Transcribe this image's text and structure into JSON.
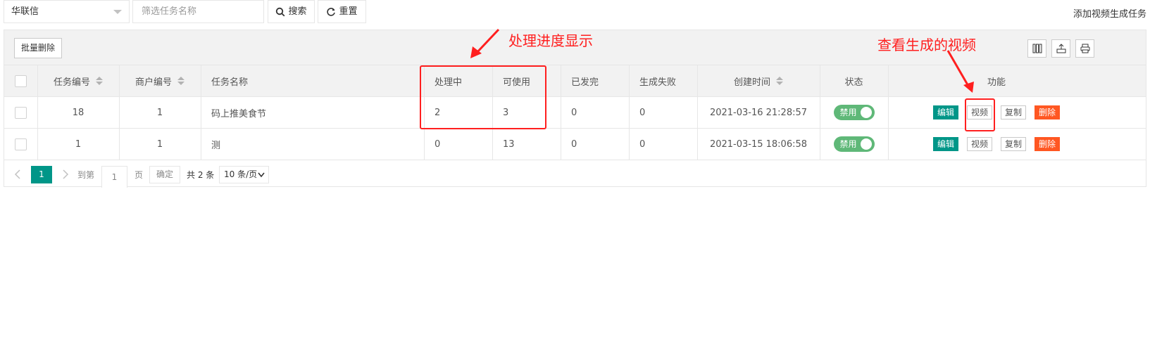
{
  "toolbar": {
    "merchant_select": "华联信",
    "task_name_placeholder": "筛选任务名称",
    "search_label": "搜索",
    "reset_label": "重置",
    "add_task_link": "添加视频生成任务"
  },
  "table_toolbar": {
    "batch_delete_label": "批量删除",
    "icons": [
      "columns-icon",
      "export-icon",
      "print-icon"
    ]
  },
  "columns": {
    "task_id": "任务编号",
    "merchant_id": "商户编号",
    "task_name": "任务名称",
    "processing": "处理中",
    "available": "可使用",
    "sent": "已发完",
    "failed": "生成失败",
    "created_at": "创建时间",
    "status": "状态",
    "actions": "功能"
  },
  "rows": [
    {
      "task_id": "18",
      "merchant_id": "1",
      "task_name": "码上推美食节",
      "processing": "2",
      "available": "3",
      "sent": "0",
      "failed": "0",
      "created_at": "2021-03-16 21:28:57",
      "status": "禁用"
    },
    {
      "task_id": "1",
      "merchant_id": "1",
      "task_name": "测",
      "processing": "0",
      "available": "13",
      "sent": "0",
      "failed": "0",
      "created_at": "2021-03-15 18:06:58",
      "status": "禁用"
    }
  ],
  "row_actions": {
    "edit": "编辑",
    "video": "视频",
    "copy": "复制",
    "delete": "删除"
  },
  "pager": {
    "current_page": "1",
    "goto_label": "到第",
    "goto_value": "1",
    "page_suffix": "页",
    "confirm_label": "确定",
    "total_label": "共 2 条",
    "page_size": "10 条/页"
  },
  "annotations": {
    "progress_note": "处理进度显示",
    "video_note": "查看生成的视频"
  },
  "colors": {
    "annotation_red": "#ff1f1f",
    "switch_green": "#5fb878",
    "edit_teal": "#009688",
    "delete_orange": "#ff5722"
  }
}
